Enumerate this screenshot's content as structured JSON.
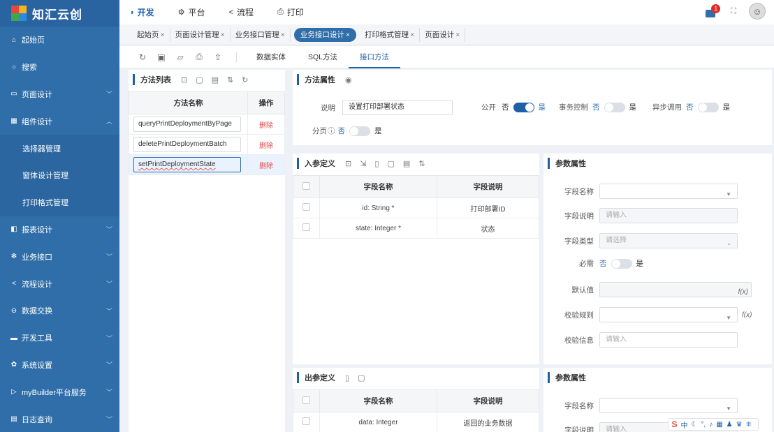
{
  "app": {
    "title": "知汇云创"
  },
  "sidebar": {
    "items": [
      {
        "label": "起始页",
        "icon": "home-icon",
        "glyph": "⌂",
        "chev": false
      },
      {
        "label": "搜索",
        "icon": "search-icon",
        "glyph": "○",
        "chev": false
      },
      {
        "label": "页面设计",
        "icon": "page-icon",
        "glyph": "▭",
        "chev": true
      },
      {
        "label": "组件设计",
        "icon": "grid-icon",
        "glyph": "▦",
        "chev": true,
        "open": true
      },
      {
        "label": "选择器管理",
        "sub": true
      },
      {
        "label": "窗体设计管理",
        "sub": true
      },
      {
        "label": "打印格式管理",
        "sub": true
      },
      {
        "label": "报表设计",
        "icon": "report-icon",
        "glyph": "◧",
        "chev": true
      },
      {
        "label": "业务接口",
        "icon": "interface-icon",
        "glyph": "✻",
        "chev": true
      },
      {
        "label": "流程设计",
        "icon": "flow-icon",
        "glyph": "<",
        "chev": true
      },
      {
        "label": "数据交换",
        "icon": "database-icon",
        "glyph": "⊖",
        "chev": true
      },
      {
        "label": "开发工具",
        "icon": "tools-icon",
        "glyph": "▬",
        "chev": true
      },
      {
        "label": "系统设置",
        "icon": "gear-icon",
        "glyph": "✿",
        "chev": true
      },
      {
        "label": "myBuilder平台服务",
        "icon": "service-icon",
        "glyph": "▷",
        "chev": true
      },
      {
        "label": "日志查询",
        "icon": "log-icon",
        "glyph": "▤",
        "chev": true
      }
    ]
  },
  "topnav": {
    "items": [
      {
        "label": "开发",
        "glyph": "◑",
        "active": true
      },
      {
        "label": "平台",
        "glyph": "⚙",
        "active": false
      },
      {
        "label": "流程",
        "glyph": "<",
        "active": false
      },
      {
        "label": "打印",
        "glyph": "⎙",
        "active": false
      }
    ],
    "badge": "1"
  },
  "tabs": [
    {
      "label": "起始页",
      "active": false
    },
    {
      "label": "页面设计管理",
      "active": false
    },
    {
      "label": "业务接口管理",
      "active": false
    },
    {
      "label": "业务接口设计",
      "active": true
    },
    {
      "label": "打印格式管理",
      "active": false
    },
    {
      "label": "页面设计",
      "active": false
    }
  ],
  "toolbar": {
    "tabs": [
      {
        "label": "数据实体",
        "active": false
      },
      {
        "label": "SQL方法",
        "active": false
      },
      {
        "label": "接口方法",
        "active": true
      }
    ]
  },
  "method_list": {
    "title": "方法列表",
    "col_name": "方法名称",
    "col_op": "操作",
    "rows": [
      {
        "name": "queryPrintDeploymentByPage",
        "op": "删除",
        "selected": false
      },
      {
        "name": "deletePrintDeploymentBatch",
        "op": "删除",
        "selected": false
      },
      {
        "name": "setPrintDeploymentState",
        "op": "删除",
        "selected": true
      }
    ]
  },
  "method_props": {
    "title": "方法属性",
    "desc_label": "说明",
    "desc_value": "设置打印部署状态",
    "public_label": "公开",
    "public_on": true,
    "tx_label": "事务控制",
    "tx_on": false,
    "async_label": "异步调用",
    "async_on": false,
    "paging_label": "分页",
    "paging_on": false,
    "no": "否",
    "yes": "是"
  },
  "in_params": {
    "title": "入参定义",
    "col_name": "字段名称",
    "col_desc": "字段说明",
    "rows": [
      {
        "name": "id: String *",
        "desc": "打印部署ID"
      },
      {
        "name": "state: Integer *",
        "desc": "状态"
      }
    ]
  },
  "param_props": {
    "title": "参数属性",
    "field_name": "字段名称",
    "field_desc": "字段说明",
    "field_desc_ph": "请输入",
    "field_type": "字段类型",
    "field_type_ph": "请选择",
    "required": "必需",
    "default_val": "默认值",
    "rule": "校验规则",
    "msg": "校验信息",
    "msg_ph": "请输入",
    "fx": "f(x)"
  },
  "out_params": {
    "title": "出参定义",
    "col_name": "字段名称",
    "col_desc": "字段说明",
    "rows": [
      {
        "name": "data: Integer",
        "desc": "返回的业务数据"
      }
    ]
  },
  "param_props2": {
    "title": "参数属性",
    "field_name": "字段名称",
    "field_desc": "字段说明",
    "field_desc_ph": "请输入"
  },
  "ime": {
    "label": "中"
  }
}
